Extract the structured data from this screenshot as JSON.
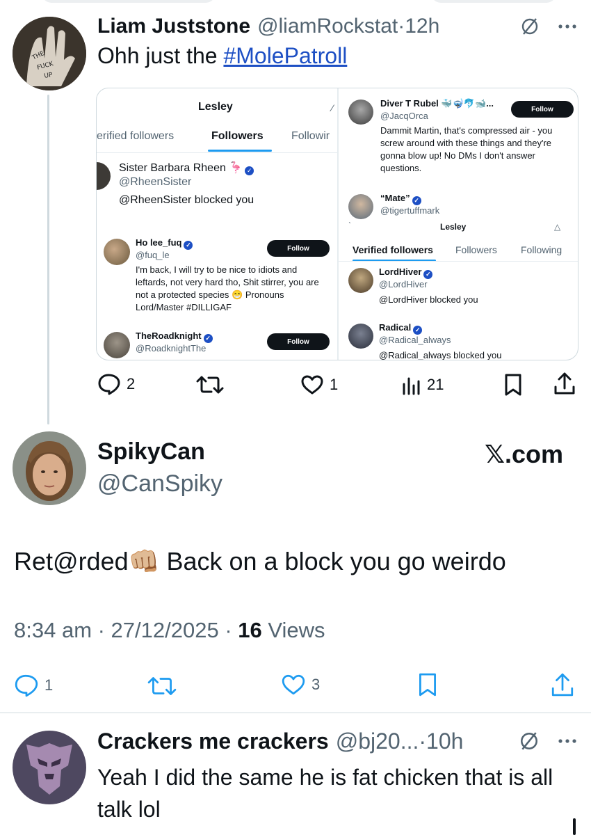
{
  "tweet1": {
    "author_name": "Liam Juststone",
    "author_handle": "@liamRockstat",
    "time": "·12h",
    "text_prefix": "Ohh just the ",
    "hashtag": "#MolePatroll",
    "stats": {
      "replies": "2",
      "likes": "1",
      "views": "21"
    },
    "embedded_screenshot": {
      "left": {
        "title": "Lesley",
        "tabs": [
          "erified followers",
          "Followers",
          "Followir"
        ],
        "blocked_user": {
          "name": "Sister Barbara Rheen",
          "emoji": "🦩",
          "handle": "@RheenSister",
          "message": "@RheenSister blocked you"
        },
        "users": [
          {
            "name": "Ho lee_fuq",
            "handle": "@fuq_le",
            "bio": "I'm back, I will try to be nice to idiots and leftards, not very hard tho, Shit stirrer, you are not a protected species 😁 Pronouns Lord/Master #DILLIGAF",
            "button": "Follow"
          },
          {
            "name": "TheRoadknight",
            "handle": "@RoadknightThe",
            "button": "Follow"
          }
        ]
      },
      "right": {
        "top_user": {
          "name": "Diver T Rubel",
          "emojis": "🐳🤿🐬🐋...",
          "handle": "@JacqOrca",
          "bio": "Dammit Martin, that's compressed air - you screw around with these things and they're gonna blow up! No DMs I don't answer questions.",
          "button": "Follow"
        },
        "mate": {
          "name": "“Mate”",
          "handle": "@tigertuffmark"
        },
        "title": "Lesley",
        "tabs": [
          "Verified followers",
          "Followers",
          "Following"
        ],
        "blocked_users": [
          {
            "name": "LordHiver",
            "handle": "@LordHiver",
            "message": "@LordHiver blocked you"
          },
          {
            "name": "Radical",
            "handle": "@Radical_always",
            "message": "@Radical_always blocked you"
          }
        ]
      }
    }
  },
  "tweet2": {
    "author_name": "SpikyCan",
    "author_handle": "@CanSpiky",
    "brand": "𝕏.com",
    "text": "Ret@rded👊🏼 Back on a block you go weirdo",
    "meta_time": "8:34 am · 27/12/2025 · ",
    "meta_views_count": "16",
    "meta_views_label": " Views",
    "stats": {
      "replies": "1",
      "likes": "3"
    }
  },
  "tweet3": {
    "author_name": "Crackers me crackers",
    "author_handle": "@bj20...",
    "time": "·10h",
    "text": "Yeah I did the same he is fat chicken that is all talk lol"
  },
  "colors": {
    "link": "#1d4fc4",
    "muted": "#536471",
    "text": "#0f1419",
    "border": "#cfd9de",
    "tab_accent": "#1d9bf0"
  }
}
